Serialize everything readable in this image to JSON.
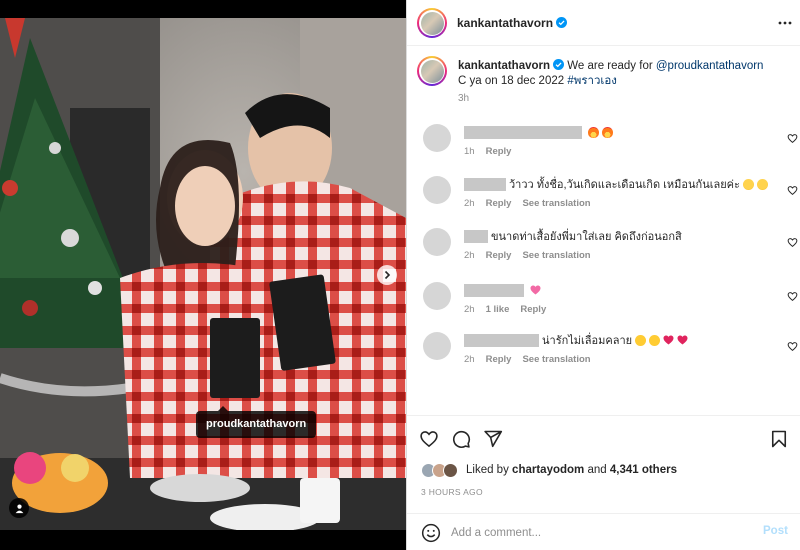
{
  "post": {
    "username": "kankantathavorn",
    "verified": true,
    "caption_text": "We are ready for",
    "caption_mention": "@proudkantathavorn",
    "caption_line2": "C ya on 18 dec 2022",
    "caption_hashtag": "#พราวเอง",
    "caption_time": "3h"
  },
  "media": {
    "tag_label": "proudkantathavorn",
    "carousel": {
      "current": 1,
      "total": 2
    }
  },
  "comments": [
    {
      "text": "",
      "emoji": [
        "fire-emoji",
        "fire-emoji"
      ],
      "time": "1h",
      "likes": "",
      "reply": "Reply",
      "translate": ""
    },
    {
      "text": "ว้าวว ทั้งชื่อ,วันเกิดและเดือนเกิด เหมือนกันเลยค่ะ",
      "emoji": [
        "laughing-emoji",
        "laughing-emoji"
      ],
      "time": "2h",
      "likes": "",
      "reply": "Reply",
      "translate": "See translation"
    },
    {
      "text": "ขนาดท่าเสื้อยังพี่มาใส่เลย คิดถึงก่อนอกสิ",
      "emoji": [],
      "time": "2h",
      "likes": "",
      "reply": "Reply",
      "translate": "See translation"
    },
    {
      "text": "",
      "emoji": [
        "sparkling-heart-emoji"
      ],
      "time": "2h",
      "likes": "1 like",
      "reply": "Reply",
      "translate": ""
    },
    {
      "text": "น่ารักไม่เลื่อมคลาย",
      "emoji": [
        "heart-eyes-emoji",
        "heart-eyes-emoji",
        "red-heart-emoji",
        "red-heart-emoji"
      ],
      "time": "2h",
      "likes": "",
      "reply": "Reply",
      "translate": "See translation"
    }
  ],
  "actions": {
    "liked_by_prefix": "Liked by",
    "liked_by_user": "chartayodom",
    "liked_by_and": "and",
    "liked_by_others": "4,341 others",
    "timestamp": "3 HOURS AGO"
  },
  "comment_box": {
    "placeholder": "Add a comment...",
    "post_label": "Post"
  },
  "colors": {
    "link": "#00376b",
    "verified": "#0095f6",
    "post_disabled": "#b2dffc",
    "muted_text": "#8e8e8e"
  },
  "icons": [
    "more-icon",
    "verified-icon",
    "heart-icon",
    "comment-icon",
    "share-icon",
    "save-icon",
    "emoji-icon",
    "chevron-right-icon",
    "user-tag-icon"
  ]
}
